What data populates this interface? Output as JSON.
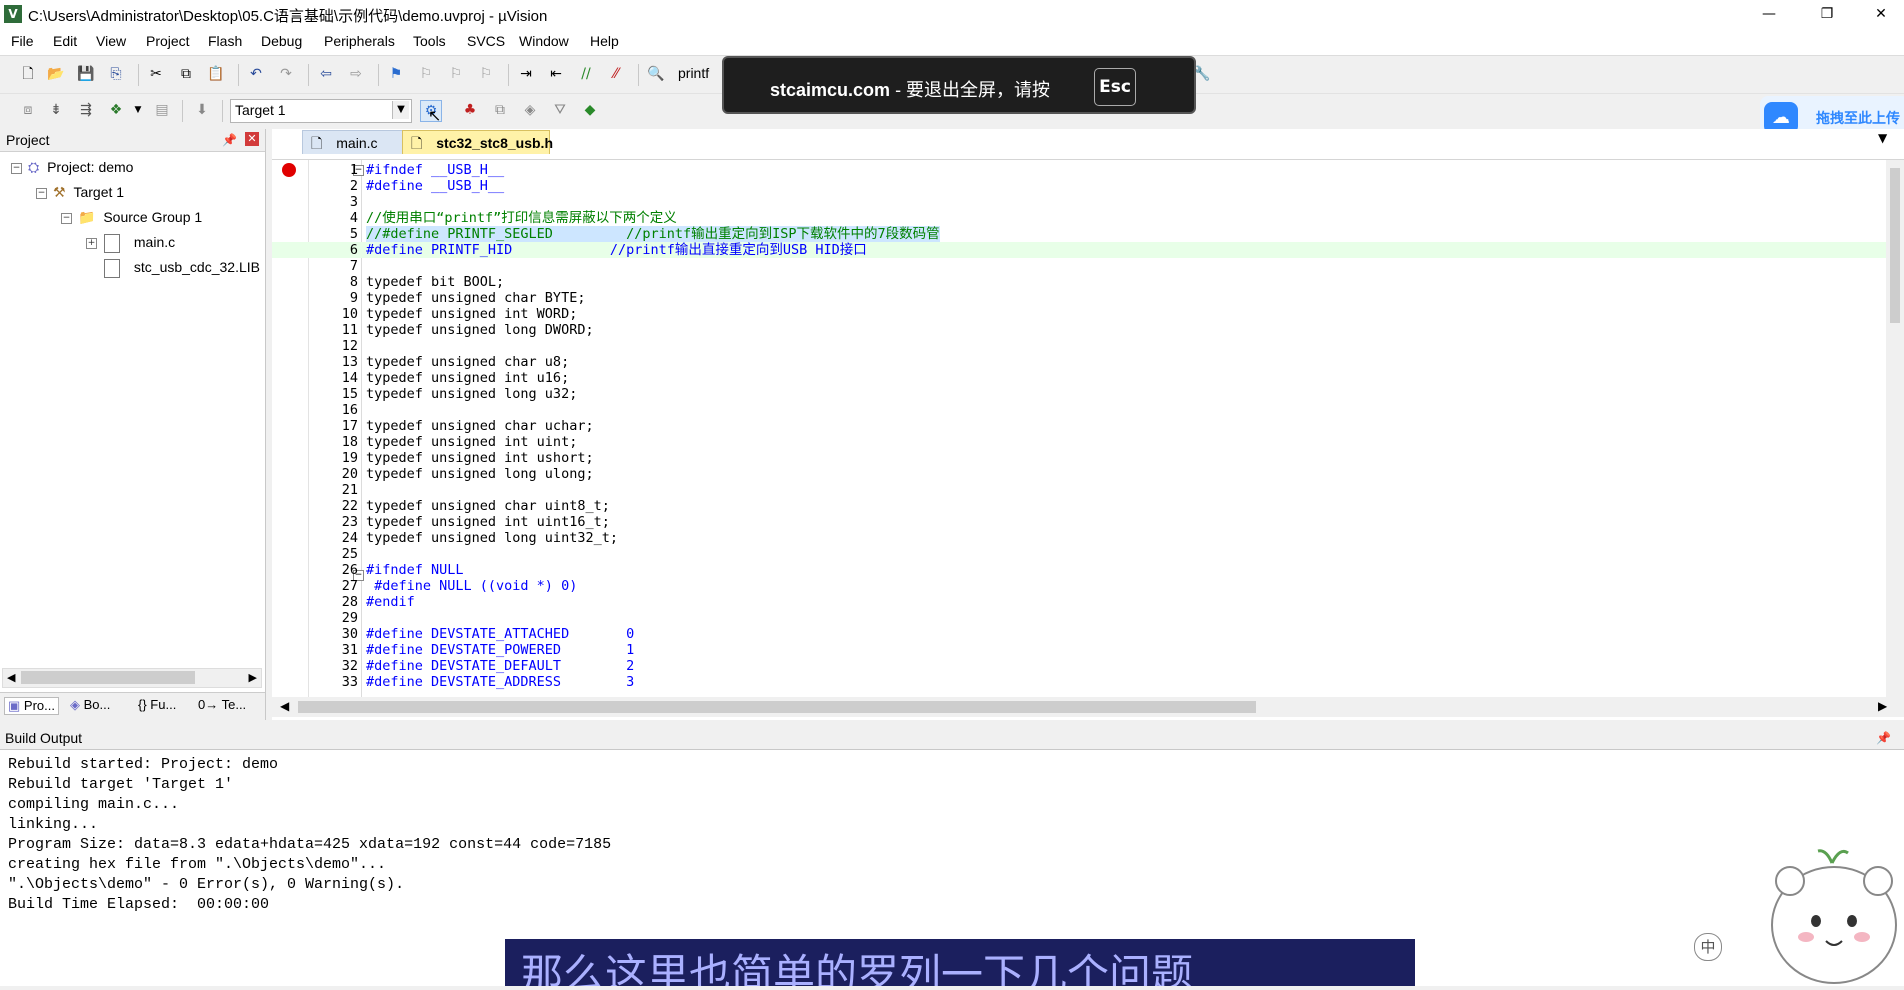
{
  "window": {
    "title": "C:\\Users\\Administrator\\Desktop\\05.C语言基础\\示例代码\\demo.uvproj - µVision",
    "app_icon_letter": "V",
    "controls": [
      "—",
      "❐",
      "✕"
    ]
  },
  "menu": [
    "File",
    "Edit",
    "View",
    "Project",
    "Flash",
    "Debug",
    "Peripherals",
    "Tools",
    "SVCS",
    "Window",
    "Help"
  ],
  "toolbar": {
    "find_value": "printf",
    "target_value": "Target 1"
  },
  "overlay": {
    "domain_text": "stcaimcu.com",
    "message": " - 要退出全屏，请按",
    "key": "Esc"
  },
  "upload_widget": {
    "label": "拖拽至此上传"
  },
  "project_panel": {
    "title": "Project",
    "tree": {
      "project": "Project: demo",
      "target": "Target 1",
      "group": "Source Group 1",
      "files": [
        "main.c",
        "stc_usb_cdc_32.LIB"
      ]
    },
    "bottom_tabs": [
      "Pro...",
      "Bo...",
      "{} Fu...",
      "0→ Te..."
    ]
  },
  "editor": {
    "tabs": [
      "main.c",
      "stc32_stc8_usb.h"
    ],
    "active_tab": "stc32_stc8_usb.h",
    "lines": [
      {
        "n": "1",
        "t": "#ifndef __USB_H__"
      },
      {
        "n": "2",
        "t": "#define __USB_H__"
      },
      {
        "n": "3",
        "t": ""
      },
      {
        "n": "4",
        "t": "//使用串口“printf”打印信息需屏蔽以下两个定义"
      },
      {
        "n": "5",
        "t": "//#define PRINTF_SEGLED         //printf输出重定向到ISP下载软件中的7段数码管"
      },
      {
        "n": "6",
        "t": "#define PRINTF_HID            //printf输出直接重定向到USB HID接口"
      },
      {
        "n": "7",
        "t": ""
      },
      {
        "n": "8",
        "t": "typedef bit BOOL;"
      },
      {
        "n": "9",
        "t": "typedef unsigned char BYTE;"
      },
      {
        "n": "10",
        "t": "typedef unsigned int WORD;"
      },
      {
        "n": "11",
        "t": "typedef unsigned long DWORD;"
      },
      {
        "n": "12",
        "t": ""
      },
      {
        "n": "13",
        "t": "typedef unsigned char u8;"
      },
      {
        "n": "14",
        "t": "typedef unsigned int u16;"
      },
      {
        "n": "15",
        "t": "typedef unsigned long u32;"
      },
      {
        "n": "16",
        "t": ""
      },
      {
        "n": "17",
        "t": "typedef unsigned char uchar;"
      },
      {
        "n": "18",
        "t": "typedef unsigned int uint;"
      },
      {
        "n": "19",
        "t": "typedef unsigned int ushort;"
      },
      {
        "n": "20",
        "t": "typedef unsigned long ulong;"
      },
      {
        "n": "21",
        "t": ""
      },
      {
        "n": "22",
        "t": "typedef unsigned char uint8_t;"
      },
      {
        "n": "23",
        "t": "typedef unsigned int uint16_t;"
      },
      {
        "n": "24",
        "t": "typedef unsigned long uint32_t;"
      },
      {
        "n": "25",
        "t": ""
      },
      {
        "n": "26",
        "t": "#ifndef NULL"
      },
      {
        "n": "27",
        "t": " #define NULL ((void *) 0)"
      },
      {
        "n": "28",
        "t": "#endif"
      },
      {
        "n": "29",
        "t": ""
      },
      {
        "n": "30",
        "t": "#define DEVSTATE_ATTACHED       0"
      },
      {
        "n": "31",
        "t": "#define DEVSTATE_POWERED        1"
      },
      {
        "n": "32",
        "t": "#define DEVSTATE_DEFAULT        2"
      },
      {
        "n": "33",
        "t": "#define DEVSTATE_ADDRESS        3"
      }
    ]
  },
  "build_output": {
    "title": "Build Output",
    "lines": [
      "Rebuild started: Project: demo",
      "Rebuild target 'Target 1'",
      "compiling main.c...",
      "linking...",
      "Program Size: data=8.3 edata+hdata=425 xdata=192 const=44 code=7185",
      "creating hex file from \".\\Objects\\demo\"...",
      "\".\\Objects\\demo\" - 0 Error(s), 0 Warning(s).",
      "Build Time Elapsed:  00:00:00"
    ]
  },
  "subtitle": "那么这里也简单的罗列一下几个问题",
  "ime_badge": "中",
  "colors": {
    "selection": "#cde6ff",
    "current_line": "#e8ffe8",
    "keyword": "#0000ff",
    "comment": "#008000",
    "breakpoint": "#e00000",
    "subtitle_bg": "#1b1f5e"
  }
}
